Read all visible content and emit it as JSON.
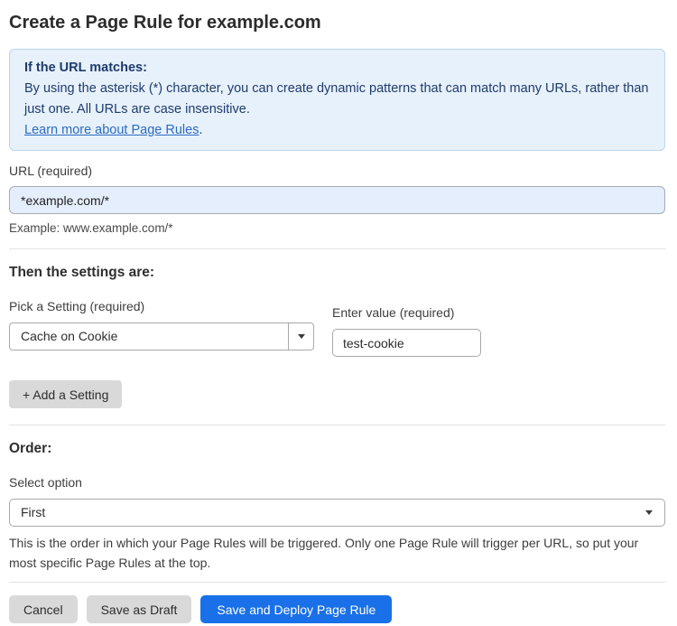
{
  "page": {
    "title": "Create a Page Rule for example.com"
  },
  "info_box": {
    "heading": "If the URL matches:",
    "body": "By using the asterisk (*) character, you can create dynamic patterns that can match many URLs, rather than just one. All URLs are case insensitive.",
    "link_label": "Learn more about Page Rules",
    "link_suffix": "."
  },
  "url_field": {
    "label": "URL (required)",
    "value": "*example.com/*",
    "example": "Example: www.example.com/*"
  },
  "settings": {
    "heading": "Then the settings are:",
    "setting_label": "Pick a Setting (required)",
    "setting_selected": "Cache on Cookie",
    "value_label": "Enter value (required)",
    "value_value": "test-cookie",
    "add_button_label": "+ Add a Setting"
  },
  "order": {
    "heading": "Order:",
    "select_label": "Select option",
    "selected": "First",
    "help": "This is the order in which your Page Rules will be triggered. Only one Page Rule will trigger per URL, so put your most specific Page Rules at the top."
  },
  "actions": {
    "cancel_label": "Cancel",
    "save_draft_label": "Save as Draft",
    "save_deploy_label": "Save and Deploy Page Rule"
  },
  "colors": {
    "info_bg": "#e7f1fb",
    "info_border": "#b9d6ee",
    "info_text": "#1e3b6e",
    "link": "#2c6bbf",
    "url_input_bg": "#e4eefc",
    "button_gray": "#d9d9d9",
    "primary_blue": "#1a70e8"
  }
}
